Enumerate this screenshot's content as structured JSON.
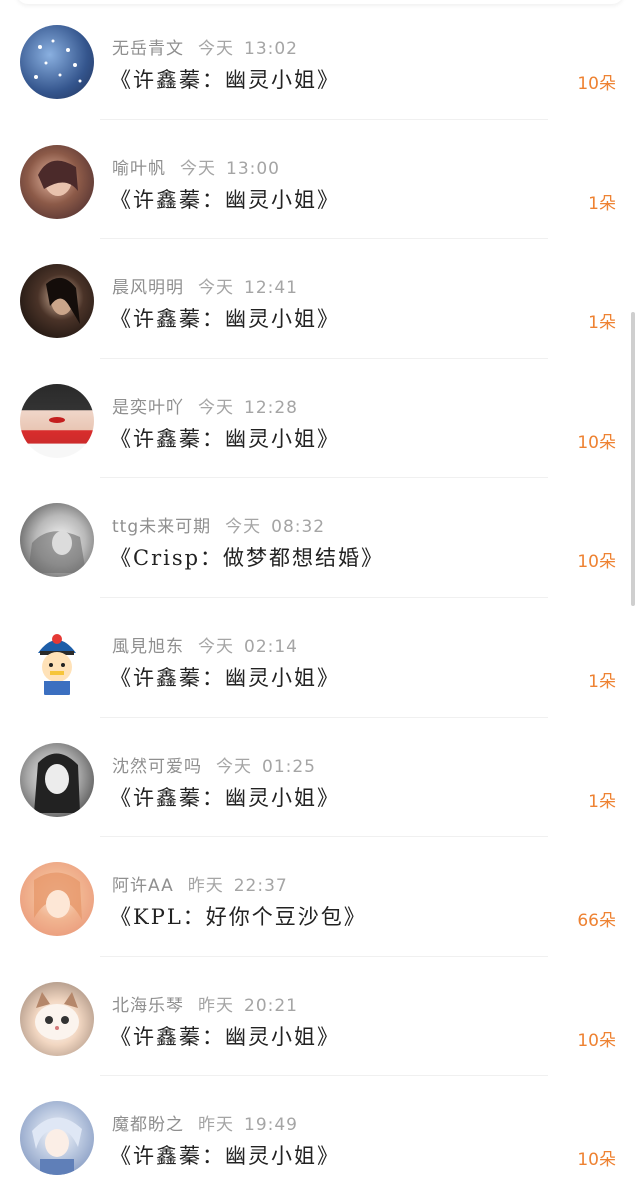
{
  "items": [
    {
      "user": "无岳青文",
      "day": "今天",
      "time": "13:02",
      "title": "《许鑫蓁：幽灵小姐》",
      "count": "10朵",
      "avatar_icon": "sky-avatar"
    },
    {
      "user": "喻叶帆",
      "day": "今天",
      "time": "13:00",
      "title": "《许鑫蓁：幽灵小姐》",
      "count": "1朵",
      "avatar_icon": "portrait-avatar"
    },
    {
      "user": "晨风明明",
      "day": "今天",
      "time": "12:41",
      "title": "《许鑫蓁：幽灵小姐》",
      "count": "1朵",
      "avatar_icon": "dark-portrait-avatar"
    },
    {
      "user": "是奕叶吖",
      "day": "今天",
      "time": "12:28",
      "title": "《许鑫蓁：幽灵小姐》",
      "count": "10朵",
      "avatar_icon": "red-lips-avatar"
    },
    {
      "user": "ttg未来可期",
      "day": "今天",
      "time": "08:32",
      "title": "《Crisp：做梦都想结婚》",
      "count": "10朵",
      "avatar_icon": "bw-portrait-avatar"
    },
    {
      "user": "風見旭东",
      "day": "今天",
      "time": "02:14",
      "title": "《许鑫蓁：幽灵小姐》",
      "count": "1朵",
      "avatar_icon": "cartoon-avatar"
    },
    {
      "user": "沈然可爱吗",
      "day": "今天",
      "time": "01:25",
      "title": "《许鑫蓁：幽灵小姐》",
      "count": "1朵",
      "avatar_icon": "girl-avatar"
    },
    {
      "user": "阿许AA",
      "day": "昨天",
      "time": "22:37",
      "title": "《KPL：好你个豆沙包》",
      "count": "66朵",
      "avatar_icon": "anime-avatar"
    },
    {
      "user": "北海乐琴",
      "day": "昨天",
      "time": "20:21",
      "title": "《许鑫蓁：幽灵小姐》",
      "count": "10朵",
      "avatar_icon": "cat-avatar"
    },
    {
      "user": "魔都盼之",
      "day": "昨天",
      "time": "19:49",
      "title": "《许鑫蓁：幽灵小姐》",
      "count": "10朵",
      "avatar_icon": "anime-boy-avatar"
    }
  ],
  "colors": {
    "accent": "#ee8232",
    "meta": "#8f8f8f",
    "title": "#222222"
  }
}
